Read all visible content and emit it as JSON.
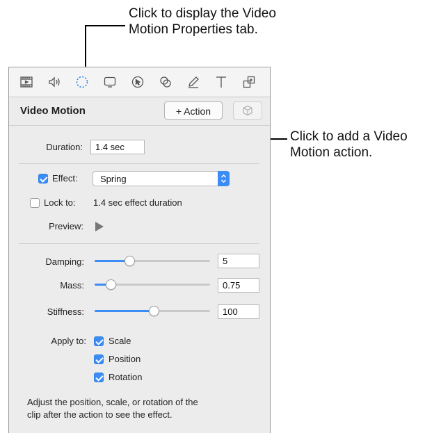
{
  "callouts": {
    "top_line1": "Click to display the Video",
    "top_line2": "Motion Properties tab.",
    "right_line1": "Click to add a Video",
    "right_line2": "Motion action."
  },
  "toolbar": {
    "icons": [
      "video-icon",
      "audio-icon",
      "video-motion-icon",
      "callout-icon",
      "cursor-icon",
      "visual-effects-icon",
      "annotation-icon",
      "text-icon",
      "behaviors-icon"
    ],
    "active_icon": "video-motion-icon",
    "accent_color": "#2d8cf0"
  },
  "header": {
    "title": "Video Motion",
    "action_button": "+ Action"
  },
  "duration": {
    "label": "Duration:",
    "value": "1.4 sec"
  },
  "effect": {
    "label": "Effect:",
    "checked": true,
    "value": "Spring"
  },
  "lock": {
    "label": "Lock to:",
    "checked": false,
    "text": "1.4 sec effect duration"
  },
  "preview": {
    "label": "Preview:"
  },
  "damping": {
    "label": "Damping:",
    "value": "5",
    "level": 0.3
  },
  "mass": {
    "label": "Mass:",
    "value": "0.75",
    "level": 0.14
  },
  "stiffness": {
    "label": "Stiffness:",
    "value": "100",
    "level": 0.51
  },
  "apply_to": {
    "label": "Apply to:",
    "options": [
      {
        "label": "Scale",
        "checked": true
      },
      {
        "label": "Position",
        "checked": true
      },
      {
        "label": "Rotation",
        "checked": true
      }
    ]
  },
  "note": {
    "line1": "Adjust the position, scale, or rotation of the",
    "line2": "clip after the action to see the effect."
  },
  "colors": {
    "accent": "#3b8df5",
    "panel_bg": "#ececec"
  }
}
